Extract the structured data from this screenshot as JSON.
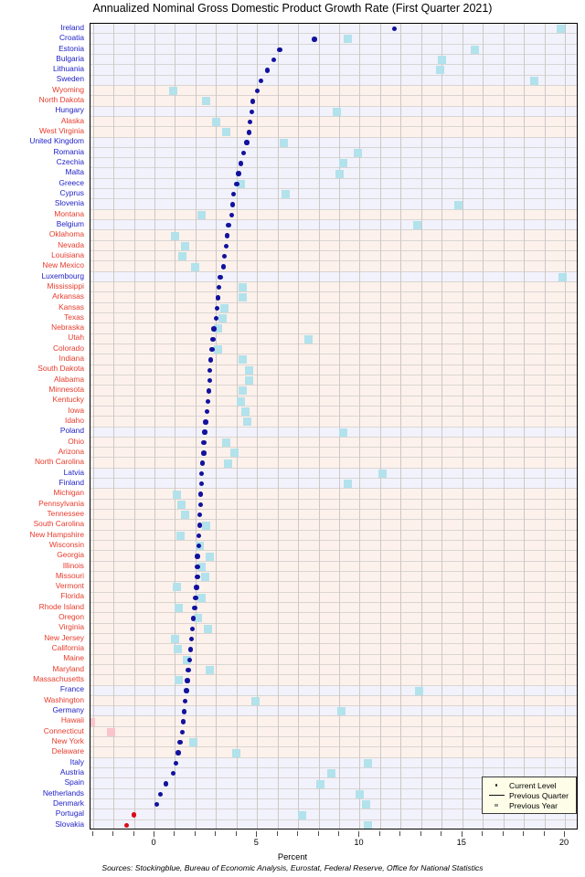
{
  "title": "Annualized Nominal Gross Domestic Product Growth Rate (First Quarter 2021)",
  "axis": {
    "xlabel": "Percent",
    "sources": "Sources: Stockingblue, Bureau of Economic Analysis, Eurostat, Federal Reserve, Office for National Statistics",
    "xticks_labeled": [
      0,
      5,
      10,
      15,
      20
    ],
    "xtick_labels": [
      "0",
      "5",
      "10",
      "15",
      "20"
    ],
    "xmin": -3.12,
    "xmax": 20.67,
    "xtick_step_minor": 1
  },
  "legend": {
    "position": "bottom-right",
    "items": [
      {
        "label": "Current Level",
        "key": "dot"
      },
      {
        "label": "Previous Quarter",
        "key": "line"
      },
      {
        "label": "Previous Year",
        "key": "square"
      }
    ]
  },
  "colors": {
    "country_label": "#2121c8",
    "state_label": "#e83b2b",
    "country_band": "#f2f2fc",
    "state_band": "#fdf1ec",
    "current_positive": "#12129e",
    "current_negative": "#d90c15",
    "previous_year_positive": "#b2e2ec",
    "previous_year_negative": "#fbc4cd"
  },
  "chart_data": {
    "type": "scatter",
    "title": "Annualized Nominal Gross Domestic Product Growth Rate (First Quarter 2021)",
    "xlabel": "Percent",
    "ylabel": "",
    "xlim": [
      -3.12,
      20.67
    ],
    "grid": true,
    "legend_position": "bottom-right",
    "series": [
      {
        "name": "Current Level",
        "marker": "dot"
      },
      {
        "name": "Previous Quarter",
        "marker": "line"
      },
      {
        "name": "Previous Year",
        "marker": "square"
      }
    ],
    "categories": [
      "Ireland",
      "Croatia",
      "Estonia",
      "Bulgaria",
      "Lithuania",
      "Sweden",
      "Wyoming",
      "North Dakota",
      "Hungary",
      "Alaska",
      "West Virginia",
      "United Kingdom",
      "Romania",
      "Czechia",
      "Malta",
      "Greece",
      "Cyprus",
      "Slovenia",
      "Montana",
      "Belgium",
      "Oklahoma",
      "Nevada",
      "Louisiana",
      "New Mexico",
      "Luxembourg",
      "Mississippi",
      "Arkansas",
      "Kansas",
      "Texas",
      "Nebraska",
      "Utah",
      "Colorado",
      "Indiana",
      "South Dakota",
      "Alabama",
      "Minnesota",
      "Kentucky",
      "Iowa",
      "Idaho",
      "Poland",
      "Ohio",
      "Arizona",
      "North Carolina",
      "Latvia",
      "Finland",
      "Michigan",
      "Pennsylvania",
      "Tennessee",
      "South Carolina",
      "New Hampshire",
      "Wisconsin",
      "Georgia",
      "Illinois",
      "Missouri",
      "Vermont",
      "Florida",
      "Rhode Island",
      "Oregon",
      "Virginia",
      "New Jersey",
      "California",
      "Maine",
      "Maryland",
      "Massachusetts",
      "France",
      "Washington",
      "Germany",
      "Hawaii",
      "Connecticut",
      "New York",
      "Delaware",
      "Italy",
      "Austria",
      "Spain",
      "Netherlands",
      "Denmark",
      "Portugal",
      "Slovakia"
    ],
    "rows": [
      {
        "label": "Ireland",
        "group": "country",
        "current": 11.7,
        "previous_year": 19.8
      },
      {
        "label": "Croatia",
        "group": "country",
        "current": 7.8,
        "previous_year": 9.4
      },
      {
        "label": "Estonia",
        "group": "country",
        "current": 6.1,
        "previous_year": 15.6
      },
      {
        "label": "Bulgaria",
        "group": "country",
        "current": 5.8,
        "previous_year": 14.0
      },
      {
        "label": "Lithuania",
        "group": "country",
        "current": 5.5,
        "previous_year": 13.9
      },
      {
        "label": "Sweden",
        "group": "country",
        "current": 5.2,
        "previous_year": 18.5
      },
      {
        "label": "Wyoming",
        "group": "state",
        "current": 5.0,
        "previous_year": 0.9
      },
      {
        "label": "North Dakota",
        "group": "state",
        "current": 4.8,
        "previous_year": 2.5
      },
      {
        "label": "Hungary",
        "group": "country",
        "current": 4.75,
        "previous_year": 8.9
      },
      {
        "label": "Alaska",
        "group": "state",
        "current": 4.65,
        "previous_year": 3.0
      },
      {
        "label": "West Virginia",
        "group": "state",
        "current": 4.6,
        "previous_year": 3.5
      },
      {
        "label": "United Kingdom",
        "group": "country",
        "current": 4.5,
        "previous_year": 6.3
      },
      {
        "label": "Romania",
        "group": "country",
        "current": 4.35,
        "previous_year": 9.9
      },
      {
        "label": "Czechia",
        "group": "country",
        "current": 4.2,
        "previous_year": 9.2
      },
      {
        "label": "Malta",
        "group": "country",
        "current": 4.1,
        "previous_year": 9.0
      },
      {
        "label": "Greece",
        "group": "country",
        "current": 4.0,
        "previous_year": 4.2
      },
      {
        "label": "Cyprus",
        "group": "country",
        "current": 3.85,
        "previous_year": 6.4
      },
      {
        "label": "Slovenia",
        "group": "country",
        "current": 3.8,
        "previous_year": 14.8
      },
      {
        "label": "Montana",
        "group": "state",
        "current": 3.75,
        "previous_year": 2.3
      },
      {
        "label": "Belgium",
        "group": "country",
        "current": 3.6,
        "previous_year": 12.8
      },
      {
        "label": "Oklahoma",
        "group": "state",
        "current": 3.55,
        "previous_year": 1.0
      },
      {
        "label": "Nevada",
        "group": "state",
        "current": 3.5,
        "previous_year": 1.5
      },
      {
        "label": "Louisiana",
        "group": "state",
        "current": 3.4,
        "previous_year": 1.35
      },
      {
        "label": "New Mexico",
        "group": "state",
        "current": 3.35,
        "previous_year": 2.0
      },
      {
        "label": "Luxembourg",
        "group": "country",
        "current": 3.2,
        "previous_year": 19.9
      },
      {
        "label": "Mississippi",
        "group": "state",
        "current": 3.15,
        "previous_year": 4.3
      },
      {
        "label": "Arkansas",
        "group": "state",
        "current": 3.1,
        "previous_year": 4.3
      },
      {
        "label": "Kansas",
        "group": "state",
        "current": 3.05,
        "previous_year": 3.4
      },
      {
        "label": "Texas",
        "group": "state",
        "current": 3.0,
        "previous_year": 3.3
      },
      {
        "label": "Nebraska",
        "group": "state",
        "current": 2.9,
        "previous_year": 3.1
      },
      {
        "label": "Utah",
        "group": "state",
        "current": 2.85,
        "previous_year": 7.5
      },
      {
        "label": "Colorado",
        "group": "state",
        "current": 2.8,
        "previous_year": 3.1
      },
      {
        "label": "Indiana",
        "group": "state",
        "current": 2.75,
        "previous_year": 4.3
      },
      {
        "label": "South Dakota",
        "group": "state",
        "current": 2.7,
        "previous_year": 4.6
      },
      {
        "label": "Alabama",
        "group": "state",
        "current": 2.7,
        "previous_year": 4.6
      },
      {
        "label": "Minnesota",
        "group": "state",
        "current": 2.65,
        "previous_year": 4.3
      },
      {
        "label": "Kentucky",
        "group": "state",
        "current": 2.6,
        "previous_year": 4.2
      },
      {
        "label": "Iowa",
        "group": "state",
        "current": 2.55,
        "previous_year": 4.45
      },
      {
        "label": "Idaho",
        "group": "state",
        "current": 2.5,
        "previous_year": 4.5
      },
      {
        "label": "Poland",
        "group": "country",
        "current": 2.45,
        "previous_year": 9.2
      },
      {
        "label": "Ohio",
        "group": "state",
        "current": 2.4,
        "previous_year": 3.5
      },
      {
        "label": "Arizona",
        "group": "state",
        "current": 2.4,
        "previous_year": 3.9
      },
      {
        "label": "North Carolina",
        "group": "state",
        "current": 2.35,
        "previous_year": 3.6
      },
      {
        "label": "Latvia",
        "group": "country",
        "current": 2.3,
        "previous_year": 11.1
      },
      {
        "label": "Finland",
        "group": "country",
        "current": 2.3,
        "previous_year": 9.4
      },
      {
        "label": "Michigan",
        "group": "state",
        "current": 2.25,
        "previous_year": 1.1
      },
      {
        "label": "Pennsylvania",
        "group": "state",
        "current": 2.25,
        "previous_year": 1.3
      },
      {
        "label": "Tennessee",
        "group": "state",
        "current": 2.2,
        "previous_year": 1.5
      },
      {
        "label": "South Carolina",
        "group": "state",
        "current": 2.2,
        "previous_year": 2.5
      },
      {
        "label": "New Hampshire",
        "group": "state",
        "current": 2.15,
        "previous_year": 1.25
      },
      {
        "label": "Wisconsin",
        "group": "state",
        "current": 2.15,
        "previous_year": 2.2
      },
      {
        "label": "Georgia",
        "group": "state",
        "current": 2.1,
        "previous_year": 2.7
      },
      {
        "label": "Illinois",
        "group": "state",
        "current": 2.1,
        "previous_year": 2.3
      },
      {
        "label": "Missouri",
        "group": "state",
        "current": 2.1,
        "previous_year": 2.45
      },
      {
        "label": "Vermont",
        "group": "state",
        "current": 2.05,
        "previous_year": 1.1
      },
      {
        "label": "Florida",
        "group": "state",
        "current": 2.0,
        "previous_year": 2.3
      },
      {
        "label": "Rhode Island",
        "group": "state",
        "current": 1.95,
        "previous_year": 1.2
      },
      {
        "label": "Oregon",
        "group": "state",
        "current": 1.9,
        "previous_year": 2.1
      },
      {
        "label": "Virginia",
        "group": "state",
        "current": 1.85,
        "previous_year": 2.6
      },
      {
        "label": "New Jersey",
        "group": "state",
        "current": 1.8,
        "previous_year": 1.0
      },
      {
        "label": "California",
        "group": "state",
        "current": 1.75,
        "previous_year": 1.15
      },
      {
        "label": "Maine",
        "group": "state",
        "current": 1.7,
        "previous_year": 1.6
      },
      {
        "label": "Maryland",
        "group": "state",
        "current": 1.65,
        "previous_year": 2.7
      },
      {
        "label": "Massachusetts",
        "group": "state",
        "current": 1.6,
        "previous_year": 1.2
      },
      {
        "label": "France",
        "group": "country",
        "current": 1.55,
        "previous_year": 12.9
      },
      {
        "label": "Washington",
        "group": "state",
        "current": 1.5,
        "previous_year": 4.9
      },
      {
        "label": "Germany",
        "group": "country",
        "current": 1.45,
        "previous_year": 9.1
      },
      {
        "label": "Hawaii",
        "group": "state",
        "current": 1.4,
        "previous_year": -3.1
      },
      {
        "label": "Connecticut",
        "group": "state",
        "current": 1.35,
        "previous_year": -2.1
      },
      {
        "label": "New York",
        "group": "state",
        "current": 1.25,
        "previous_year": 1.9
      },
      {
        "label": "Delaware",
        "group": "state",
        "current": 1.15,
        "previous_year": 4.0
      },
      {
        "label": "Italy",
        "group": "country",
        "current": 1.05,
        "previous_year": 10.4
      },
      {
        "label": "Austria",
        "group": "country",
        "current": 0.9,
        "previous_year": 8.6
      },
      {
        "label": "Spain",
        "group": "country",
        "current": 0.55,
        "previous_year": 8.1
      },
      {
        "label": "Netherlands",
        "group": "country",
        "current": 0.3,
        "previous_year": 10.0
      },
      {
        "label": "Denmark",
        "group": "country",
        "current": 0.1,
        "previous_year": 10.3
      },
      {
        "label": "Portugal",
        "group": "country",
        "current": -1.0,
        "previous_year": 7.2
      },
      {
        "label": "Slovakia",
        "group": "country",
        "current": -1.35,
        "previous_year": 10.4
      }
    ]
  }
}
